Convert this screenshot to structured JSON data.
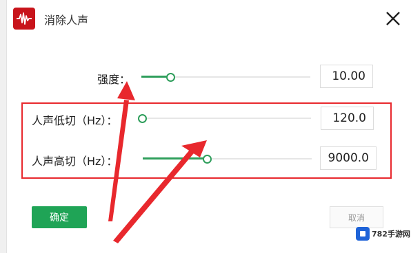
{
  "window": {
    "title": "消除人声",
    "app_icon": "waveform-icon",
    "close_icon": "close-icon"
  },
  "controls": {
    "strength": {
      "label": "强度：",
      "value": "10.00",
      "slider_fraction": 0.17
    },
    "low_cut": {
      "label": "人声低切（Hz）：",
      "value": "120.0",
      "slider_fraction": 0.0
    },
    "high_cut": {
      "label": "人声高切（Hz）：",
      "value": "9000.0",
      "slider_fraction": 0.38
    }
  },
  "buttons": {
    "ok_label": "确定",
    "cancel_label": "取消"
  },
  "annotations": {
    "highlight_color": "#e8282d",
    "arrow_color": "#e8282d"
  },
  "watermark": {
    "text": "782手游网"
  },
  "colors": {
    "accent": "#2e9e5b",
    "ok_button": "#1fa456",
    "title_icon_bg": "#c8141b"
  }
}
